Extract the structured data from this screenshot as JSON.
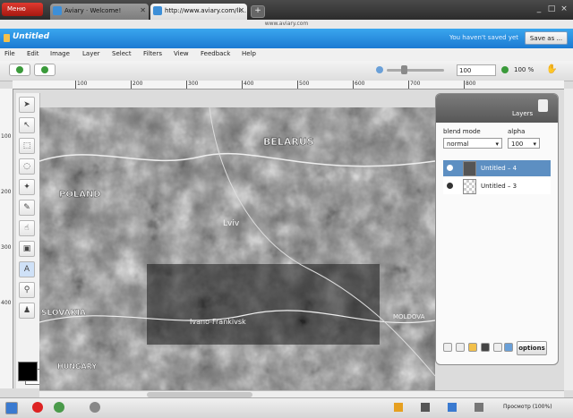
{
  "browser": {
    "menu_button": "Меню",
    "tabs": [
      {
        "title": "Aviary · Welcome!",
        "active": false
      },
      {
        "title": "http://www.aviary.com/li...",
        "active": true
      }
    ],
    "new_tab_glyph": "+",
    "address_strip": "www.aviary.com",
    "window_buttons": [
      "_",
      "□",
      "×"
    ]
  },
  "app": {
    "document_title": "Untitled",
    "unsaved_text": "You haven't saved yet",
    "save_as_label": "Save as ...",
    "menus": [
      "File",
      "Edit",
      "Image",
      "Layer",
      "Select",
      "Filters",
      "View",
      "Feedback",
      "Help"
    ],
    "zoom": {
      "value": "100",
      "percent_label": "100 %",
      "slider_fraction": 0.25
    },
    "icons": {
      "hand": "hand-icon",
      "undo": "undo-icon",
      "redo": "redo-icon"
    }
  },
  "rulers": {
    "top": [
      "0",
      "100",
      "200",
      "300",
      "400",
      "500",
      "600",
      "700",
      "800"
    ],
    "left": [
      "100",
      "200",
      "300",
      "400"
    ]
  },
  "tools": [
    "pointer-tool",
    "direct-select-tool",
    "marquee-tool",
    "lasso-tool",
    "magic-wand-tool",
    "brush-tool",
    "smudge-tool",
    "shape-tool",
    "text-tool",
    "eyedropper-tool",
    "stamp-tool"
  ],
  "canvas": {
    "labels": [
      "BELARUS",
      "POLAND",
      "Lviv",
      "Ivano-Frankivsk",
      "SLOVAKIA",
      "HUNGARY",
      "MOLDOVA"
    ]
  },
  "layers_panel": {
    "title": "Layers",
    "blend_mode_label": "blend mode",
    "blend_mode_value": "normal",
    "alpha_label": "alpha",
    "alpha_value": "100",
    "layers": [
      {
        "name": "Untitled – 4",
        "selected": true
      },
      {
        "name": "Untitled – 3",
        "selected": false
      }
    ],
    "options_label": "options"
  },
  "status": {
    "zoom_text": "Просмотр (100%)"
  },
  "colors": {
    "header_blue": "#1c7ad2",
    "selected_layer": "#5d8fc2",
    "foreground": "#000000",
    "background": "#ffffff"
  }
}
